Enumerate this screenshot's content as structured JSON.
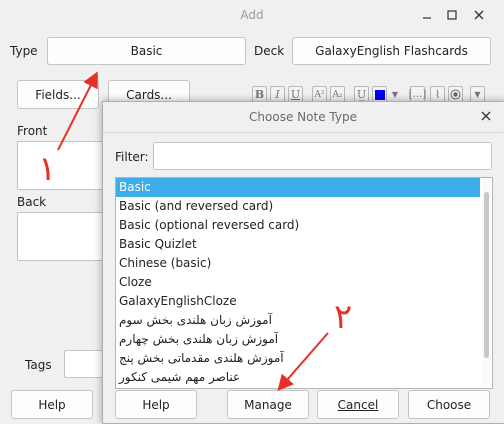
{
  "window": {
    "title": "Add"
  },
  "main": {
    "type_label": "Type",
    "type_value": "Basic",
    "deck_label": "Deck",
    "deck_value": "GalaxyEnglish Flashcards",
    "fields_button": "Fields...",
    "cards_button": "Cards...",
    "front_label": "Front",
    "back_label": "Back",
    "tags_label": "Tags",
    "help_button": "Help",
    "format_bar": {
      "bold": "B",
      "italic": "I",
      "underline": "U",
      "superscript": "A²",
      "subscript": "A₂",
      "clear": "U̲",
      "text_color": "#0000ff"
    }
  },
  "dialog": {
    "title": "Choose Note Type",
    "filter_label": "Filter:",
    "filter_value": "",
    "items": [
      "Basic",
      "Basic (and reversed card)",
      "Basic (optional reversed card)",
      "Basic Quizlet",
      "Chinese (basic)",
      "Cloze",
      "GalaxyEnglishCloze",
      "آموزش زبان هلندی بخش سوم",
      "آموزش زبان هلندی بخش چهارم",
      "آموزش هلندی مقدماتی بخش پنج",
      "عناصر مهم شیمی کنکور"
    ],
    "selected_index": 0,
    "help_button": "Help",
    "manage_button": "Manage",
    "cancel_button": "Cancel",
    "choose_button": "Choose"
  },
  "annotations": {
    "label_one": "١",
    "label_two": "٢",
    "arrow_color": "#e8302a"
  }
}
